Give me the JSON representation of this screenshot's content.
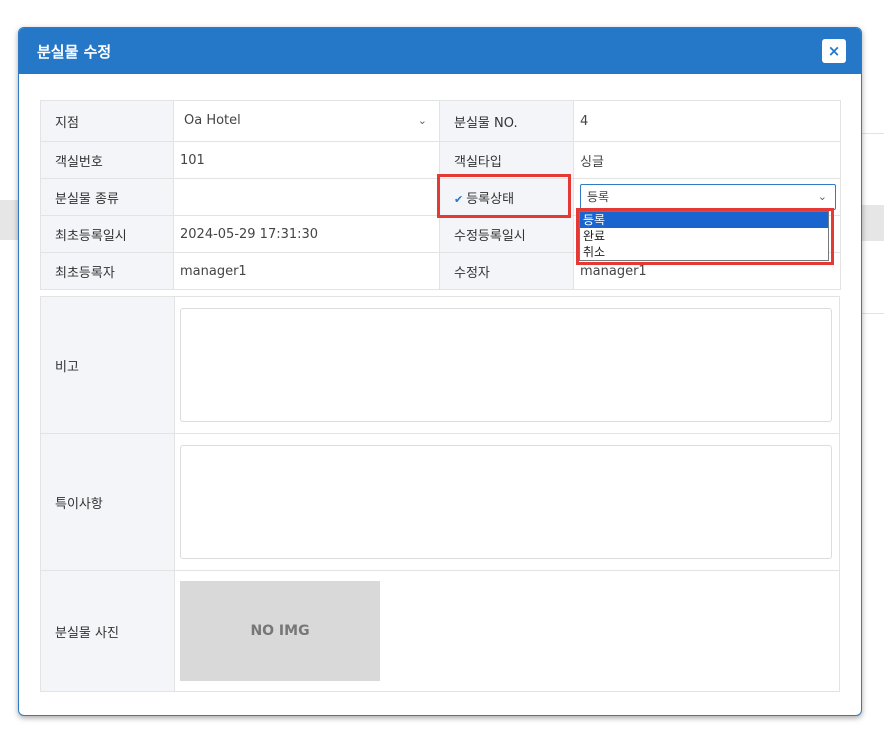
{
  "modal": {
    "title": "분실물 수정",
    "close_icon": "×"
  },
  "info": {
    "branch_label": "지점",
    "branch_value": "Oa Hotel",
    "lost_no_label": "분실물 NO.",
    "lost_no_value": "4",
    "room_no_label": "객실번호",
    "room_no_value": "101",
    "room_type_label": "객실타입",
    "room_type_value": "싱글",
    "lost_type_label": "분실물 종류",
    "lost_type_value": "",
    "status_label": "등록상태",
    "status_value": "등록",
    "created_at_label": "최초등록일시",
    "created_at_value": "2024-05-29 17:31:30",
    "updated_at_label": "수정등록일시",
    "creator_label": "최초등록자",
    "creator_value": "manager1",
    "editor_label": "수정자",
    "editor_value": "manager1"
  },
  "status_options": [
    "등록",
    "완료",
    "취소"
  ],
  "memo": {
    "note_label": "비고",
    "special_label": "특이사항",
    "photo_label": "분실물 사진",
    "no_img": "NO IMG"
  },
  "colors": {
    "header": "#2577c7",
    "highlight": "#e53935",
    "selected_option": "#1a64d0"
  }
}
